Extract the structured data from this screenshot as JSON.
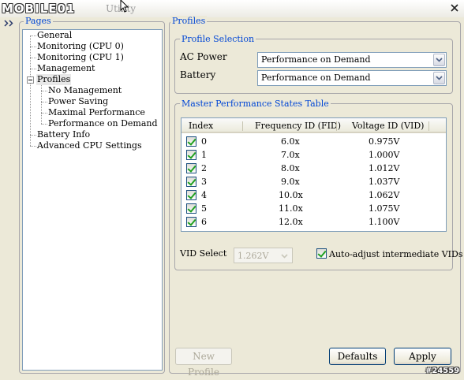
{
  "window": {
    "title": "Utility",
    "watermark": "MOBILE01"
  },
  "pages": {
    "title": "Pages",
    "items": [
      {
        "label": "General",
        "level": 1
      },
      {
        "label": "Monitoring (CPU 0)",
        "level": 1
      },
      {
        "label": "Monitoring (CPU 1)",
        "level": 1
      },
      {
        "label": "Management",
        "level": 1
      },
      {
        "label": "Profiles",
        "level": 1,
        "expanded": true,
        "selected": true
      },
      {
        "label": "No Management",
        "level": 2
      },
      {
        "label": "Power Saving",
        "level": 2
      },
      {
        "label": "Maximal Performance",
        "level": 2
      },
      {
        "label": "Performance on Demand",
        "level": 2
      },
      {
        "label": "Battery Info",
        "level": 1
      },
      {
        "label": "Advanced CPU Settings",
        "level": 1
      }
    ]
  },
  "profiles": {
    "title": "Profiles",
    "selection": {
      "title": "Profile Selection",
      "ac_power_label": "AC Power",
      "ac_power_value": "Performance on Demand",
      "battery_label": "Battery",
      "battery_value": "Performance on Demand"
    },
    "table": {
      "title": "Master Performance States Table",
      "columns": [
        "Index",
        "Frequency ID (FID)",
        "Voltage ID (VID)"
      ],
      "rows": [
        {
          "checked": true,
          "index": "0",
          "fid": "6.0x",
          "vid": "0.975V"
        },
        {
          "checked": true,
          "index": "1",
          "fid": "7.0x",
          "vid": "1.000V"
        },
        {
          "checked": true,
          "index": "2",
          "fid": "8.0x",
          "vid": "1.012V"
        },
        {
          "checked": true,
          "index": "3",
          "fid": "9.0x",
          "vid": "1.037V"
        },
        {
          "checked": true,
          "index": "4",
          "fid": "10.0x",
          "vid": "1.062V"
        },
        {
          "checked": true,
          "index": "5",
          "fid": "11.0x",
          "vid": "1.075V"
        },
        {
          "checked": true,
          "index": "6",
          "fid": "12.0x",
          "vid": "1.100V"
        }
      ]
    },
    "vid_select_label": "VID Select",
    "vid_select_value": "1.262V",
    "auto_adjust_label": "Auto-adjust intermediate VIDs",
    "auto_adjust_checked": true
  },
  "buttons": {
    "new_profile": "New Profile",
    "defaults": "Defaults",
    "apply": "Apply"
  },
  "image_id": "#24559"
}
